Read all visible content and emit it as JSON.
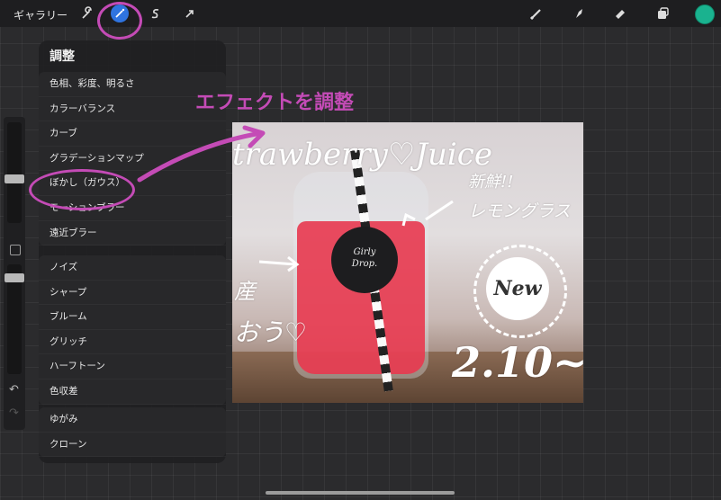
{
  "topbar": {
    "gallery_label": "ギャラリー",
    "left_tools": [
      "wrench-icon",
      "magic-wand-icon",
      "selection-s-icon",
      "transform-arrow-icon"
    ],
    "right_tools": [
      "brush-icon",
      "smudge-icon",
      "eraser-icon",
      "layers-icon"
    ],
    "active_tool": "magic-wand-icon",
    "color": "#1ab28f"
  },
  "menu": {
    "title": "調整",
    "groups": [
      [
        "色相、彩度、明るさ",
        "カラーバランス",
        "カーブ",
        "グラデーションマップ",
        "ぼかし（ガウス）",
        "モーションブラー",
        "遠近ブラー"
      ],
      [
        "ノイズ",
        "シャープ",
        "ブルーム",
        "グリッチ",
        "ハーフトーン",
        "色収差"
      ],
      [
        "ゆがみ",
        "クローン"
      ]
    ]
  },
  "annotation": {
    "text": "エフェクトを調整",
    "color": "#c44bb6"
  },
  "artwork": {
    "title_text": "trawberry♡Juice",
    "fresh_text": "新鮮!!",
    "lemongrass_text": "レモングラス",
    "label_line1": "Girly",
    "label_line2": "Drop.",
    "new_badge": "New",
    "date_text": "2.10~",
    "left_text1": "産",
    "left_text2": "おう♡"
  }
}
